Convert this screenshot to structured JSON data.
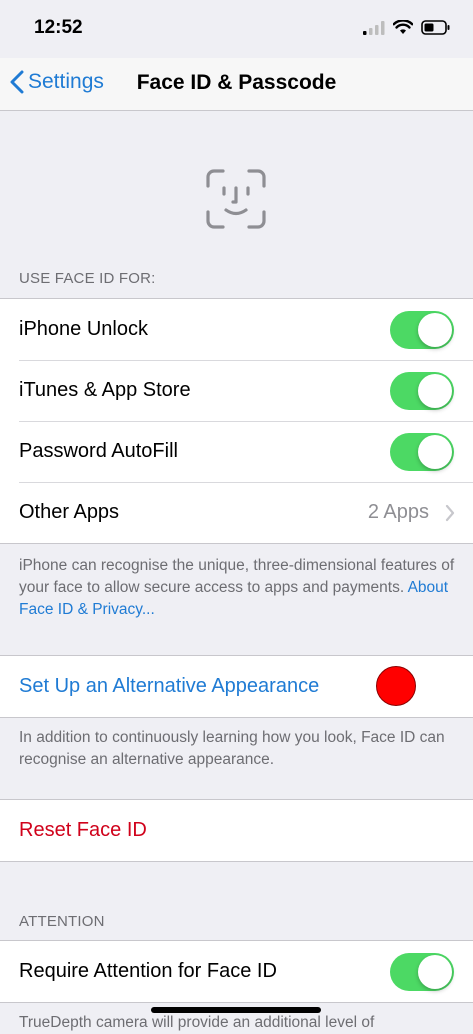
{
  "status": {
    "time": "12:52"
  },
  "nav": {
    "back_label": "Settings",
    "title": "Face ID & Passcode"
  },
  "use_face_id": {
    "header": "USE FACE ID FOR:",
    "items": [
      {
        "label": "iPhone Unlock",
        "on": true
      },
      {
        "label": "iTunes & App Store",
        "on": true
      },
      {
        "label": "Password AutoFill",
        "on": true
      }
    ],
    "other_apps": {
      "label": "Other Apps",
      "value": "2 Apps"
    },
    "footer": "iPhone can recognise the unique, three-dimensional features of your face to allow secure access to apps and payments.",
    "footer_link": "About Face ID & Privacy..."
  },
  "alternative": {
    "label": "Set Up an Alternative Appearance",
    "footer": "In addition to continuously learning how you look, Face ID can recognise an alternative appearance."
  },
  "reset": {
    "label": "Reset Face ID"
  },
  "attention": {
    "header": "ATTENTION",
    "item": {
      "label": "Require Attention for Face ID",
      "on": true
    },
    "footer": "TrueDepth camera will provide an additional level of"
  },
  "colors": {
    "accent": "#1f7bd4",
    "toggle_on": "#4cd964",
    "destructive": "#d0021b",
    "marker": "#ff0000"
  }
}
